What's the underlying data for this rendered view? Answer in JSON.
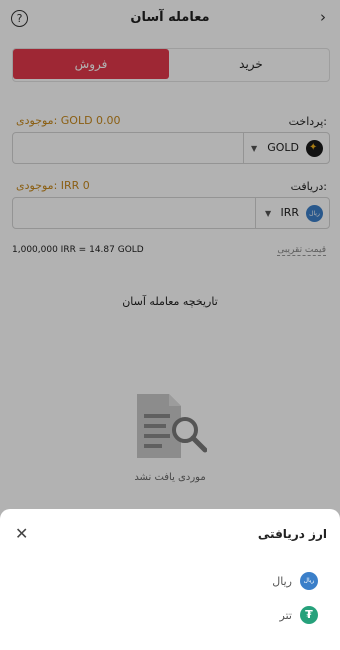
{
  "header": {
    "title": "معامله آسان",
    "help": "?",
    "back": "›"
  },
  "tabs": {
    "buy": "خرید",
    "sell": "فروش"
  },
  "payment": {
    "label": "پرداخت:",
    "balance": "موجودی: GOLD 0.00",
    "currency": "GOLD",
    "value": ""
  },
  "receive": {
    "label": "دریافت:",
    "balance": "موجودی: IRR 0",
    "currency": "IRR",
    "value": ""
  },
  "rate": {
    "text": "1,000,000 IRR = 14.87 GOLD",
    "label": "قیمت تقریبی"
  },
  "history": {
    "title": "تاریخچه معامله آسان",
    "empty": "موردی یافت نشد"
  },
  "sheet": {
    "title": "ارز دریافتی",
    "options": [
      {
        "label": "ریال",
        "icon": "rial-icon",
        "badge": "ریال"
      },
      {
        "label": "تتر",
        "icon": "tether-icon",
        "badge": "₮"
      }
    ]
  },
  "colors": {
    "accent": "#e3394b",
    "balance": "#c7891d",
    "rial": "#3b7fc9",
    "tether": "#26a17b"
  }
}
